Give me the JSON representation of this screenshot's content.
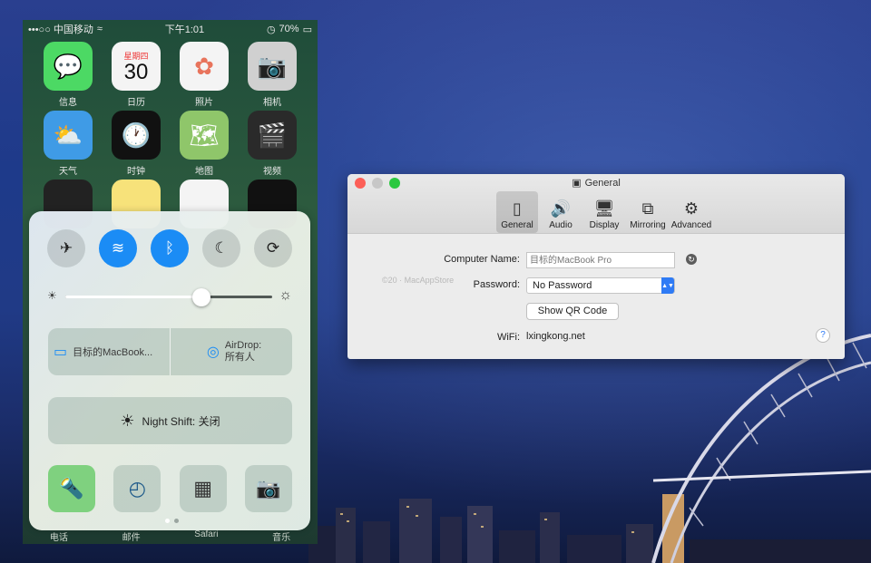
{
  "iphone": {
    "status": {
      "carrier": "•••○○ 中国移动",
      "time": "下午1:01",
      "battery": "70%"
    },
    "apps": [
      {
        "label": "信息",
        "icon": "messages-icon",
        "color": "#4cd964",
        "glyph": "💬"
      },
      {
        "label": "日历",
        "icon": "calendar-icon",
        "color": "#f4f4f4",
        "glyph": "30",
        "sub": "星期四"
      },
      {
        "label": "照片",
        "icon": "photos-icon",
        "color": "#f4f4f4",
        "glyph": "✿"
      },
      {
        "label": "相机",
        "icon": "camera-app-icon",
        "color": "#d0d0d0",
        "glyph": "📷"
      },
      {
        "label": "天气",
        "icon": "weather-icon",
        "color": "#3f9be6",
        "glyph": "⛅"
      },
      {
        "label": "时钟",
        "icon": "clock-icon",
        "color": "#111111",
        "glyph": "🕐"
      },
      {
        "label": "地图",
        "icon": "maps-icon",
        "color": "#8fc66a",
        "glyph": "🗺"
      },
      {
        "label": "视频",
        "icon": "videos-icon",
        "color": "#2a2a2a",
        "glyph": "🎬"
      }
    ],
    "dock": [
      "电话",
      "邮件",
      "Safari",
      "音乐"
    ]
  },
  "control_center": {
    "brightness": 0.66,
    "airplay_label": "目标的MacBook...",
    "airdrop_title": "AirDrop:",
    "airdrop_value": "所有人",
    "nightshift_label": "Night Shift: 关闭"
  },
  "prefs_window": {
    "title": "General",
    "tabs": [
      {
        "label": "General",
        "icon": "general-icon",
        "glyph": "▯"
      },
      {
        "label": "Audio",
        "icon": "speaker-icon",
        "glyph": "🔊"
      },
      {
        "label": "Display",
        "icon": "display-icon",
        "glyph": "🖥"
      },
      {
        "label": "Mirroring",
        "icon": "mirroring-icon",
        "glyph": "⧉"
      },
      {
        "label": "Advanced",
        "icon": "gear-icon",
        "glyph": "⚙"
      }
    ],
    "computer_name_label": "Computer Name:",
    "computer_name_placeholder": "目标的MacBook Pro",
    "password_label": "Password:",
    "password_value": "No Password",
    "qr_button": "Show QR Code",
    "wifi_label": "WiFi:",
    "wifi_value": "lxingkong.net",
    "watermark": "©20 · MacAppStore",
    "help": "?"
  }
}
